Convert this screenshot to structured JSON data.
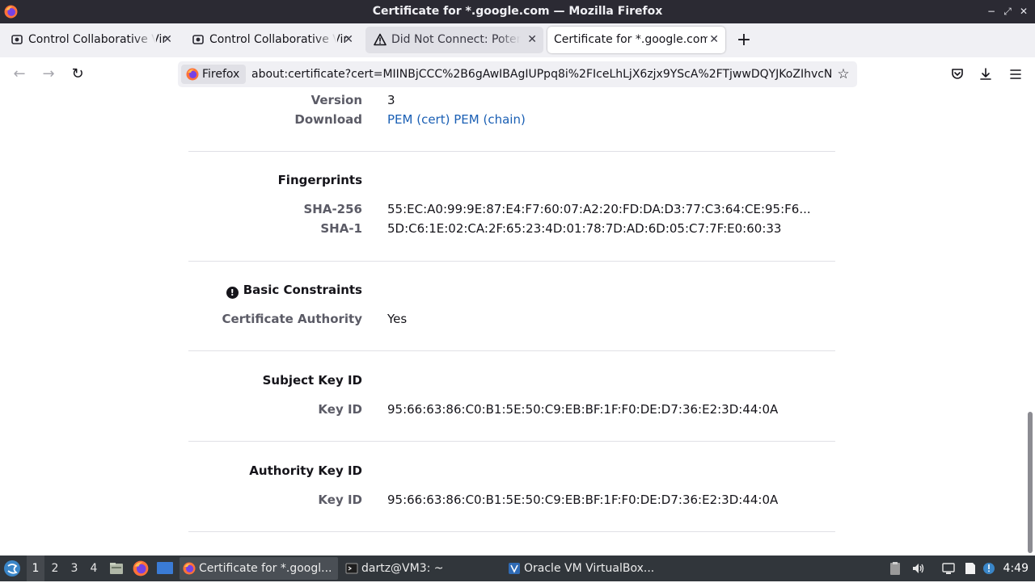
{
  "window": {
    "title": "Certificate for *.google.com — Mozilla Firefox",
    "minimize": "−",
    "maximize": "⤢",
    "close": "✕"
  },
  "tabs": [
    {
      "label": "Control Collaborative Virt",
      "icon": "vm-icon",
      "close": "✕"
    },
    {
      "label": "Control Collaborative Virt",
      "icon": "vm-icon",
      "close": "✕"
    },
    {
      "label": "Did Not Connect: Potent",
      "icon": "warning-icon",
      "close": "✕"
    },
    {
      "label": "Certificate for *.google.com",
      "icon": "none",
      "close": "✕"
    }
  ],
  "newtab": "+",
  "nav": {
    "back": "←",
    "forward": "→",
    "reload": "↻",
    "identity_label": "Firefox",
    "url": "about:certificate?cert=MIINBjCCC%2B6gAwIBAgIUPpq8i%2FIceLhLjX6zjx9YScA%2FTjwwDQYJKoZIhvcN",
    "star": "☆",
    "pocket": "pocket-icon",
    "download": "⤓",
    "menu": "≡"
  },
  "sections": {
    "misc": {
      "version_label": "Version",
      "version_value": "3",
      "download_label": "Download",
      "pem_cert": "PEM (cert)",
      "pem_chain": "PEM (chain)"
    },
    "fingerprints": {
      "heading": "Fingerprints",
      "sha256_label": "SHA-256",
      "sha256_value": "55:EC:A0:99:9E:87:E4:F7:60:07:A2:20:FD:DA:D3:77:C3:64:CE:95:F6...",
      "sha1_label": "SHA-1",
      "sha1_value": "5D:C6:1E:02:CA:2F:65:23:4D:01:78:7D:AD:6D:05:C7:7F:E0:60:33"
    },
    "basic_constraints": {
      "icon_glyph": "!",
      "heading": "Basic Constraints",
      "ca_label": "Certificate Authority",
      "ca_value": "Yes"
    },
    "subject_key_id": {
      "heading": "Subject Key ID",
      "key_label": "Key ID",
      "key_value": "95:66:63:86:C0:B1:5E:50:C9:EB:BF:1F:F0:DE:D7:36:E2:3D:44:0A"
    },
    "authority_key_id": {
      "heading": "Authority Key ID",
      "key_label": "Key ID",
      "key_value": "95:66:63:86:C0:B1:5E:50:C9:EB:BF:1F:F0:DE:D7:36:E2:3D:44:0A"
    }
  },
  "taskbar": {
    "workspaces": [
      "1",
      "2",
      "3",
      "4"
    ],
    "tasks": [
      {
        "label": "Certificate for *.googl...",
        "icon": "firefox-icon"
      },
      {
        "label": "dartz@VM3: ~",
        "icon": "terminal-icon"
      },
      {
        "label": "Oracle VM VirtualBox...",
        "icon": "virtualbox-icon"
      }
    ],
    "clock": "4:49"
  }
}
